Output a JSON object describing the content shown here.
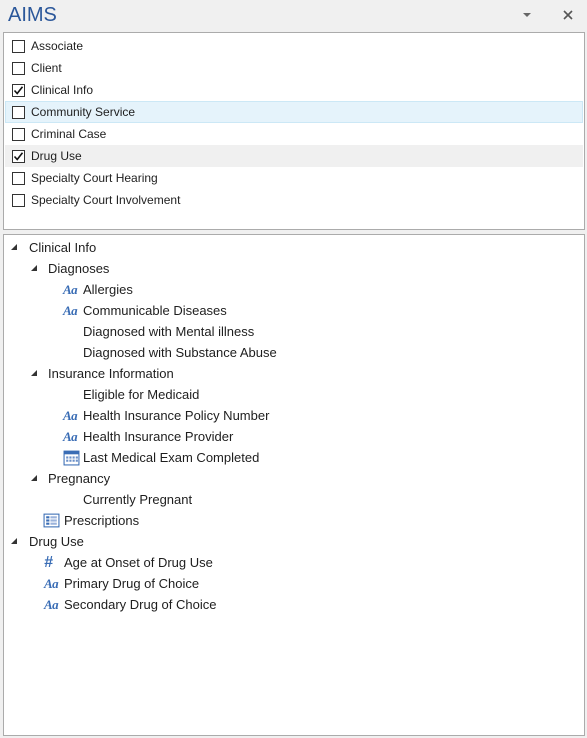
{
  "window": {
    "title": "AIMS",
    "dropdown_icon": "chevron-down-icon",
    "close_icon": "close-icon"
  },
  "categories": [
    {
      "label": "Associate",
      "checked": false
    },
    {
      "label": "Client",
      "checked": false
    },
    {
      "label": "Clinical Info",
      "checked": true
    },
    {
      "label": "Community Service",
      "checked": false,
      "state": "hover"
    },
    {
      "label": "Criminal Case",
      "checked": false
    },
    {
      "label": "Drug Use",
      "checked": true,
      "state": "selected"
    },
    {
      "label": "Specialty Court Hearing",
      "checked": false
    },
    {
      "label": "Specialty Court Involvement",
      "checked": false
    }
  ],
  "tree": {
    "clinical_info": {
      "label": "Clinical Info",
      "diagnoses": {
        "label": "Diagnoses",
        "items": [
          {
            "label": "Allergies",
            "icon": "text-field-icon"
          },
          {
            "label": "Communicable Diseases",
            "icon": "text-field-icon"
          },
          {
            "label": "Diagnosed with Mental illness",
            "icon": ""
          },
          {
            "label": "Diagnosed with Substance Abuse",
            "icon": ""
          }
        ]
      },
      "insurance": {
        "label": "Insurance Information",
        "items": [
          {
            "label": "Eligible for Medicaid",
            "icon": ""
          },
          {
            "label": "Health Insurance Policy Number",
            "icon": "text-field-icon"
          },
          {
            "label": "Health Insurance Provider",
            "icon": "text-field-icon"
          },
          {
            "label": "Last Medical Exam Completed",
            "icon": "calendar-icon"
          }
        ]
      },
      "pregnancy": {
        "label": "Pregnancy",
        "items": [
          {
            "label": "Currently Pregnant",
            "icon": ""
          }
        ]
      },
      "prescriptions": {
        "label": "Prescriptions",
        "icon": "list-table-icon"
      }
    },
    "drug_use": {
      "label": "Drug Use",
      "items": [
        {
          "label": "Age at Onset of Drug Use",
          "icon": "number-field-icon"
        },
        {
          "label": "Primary Drug of Choice",
          "icon": "text-field-icon"
        },
        {
          "label": "Secondary Drug of Choice",
          "icon": "text-field-icon"
        }
      ]
    }
  },
  "colors": {
    "title": "#2b579a",
    "field_icon": "#3a6db5",
    "hover_row": "#e5f3fb",
    "selected_row": "#f0f0f0"
  }
}
